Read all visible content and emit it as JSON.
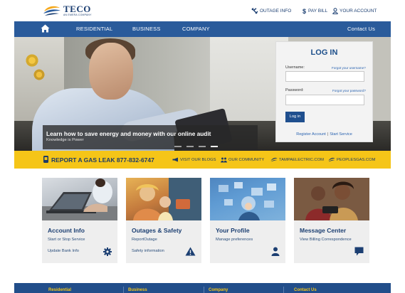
{
  "brand": {
    "name": "TECO",
    "tagline": "AN EMERA COMPANY"
  },
  "utility_links": {
    "outage": "OUTAGE INFO",
    "pay": "PAY BILL",
    "account": "YOUR ACCOUNT"
  },
  "nav": {
    "items": [
      "RESIDENTIAL",
      "BUSINESS",
      "COMPANY"
    ],
    "contact": "Contact Us"
  },
  "hero": {
    "title": "Learn how to save energy and money with our online audit",
    "subtitle": "Knowledge is Power",
    "slides_total": 4,
    "slide_active": 4
  },
  "login": {
    "title": "LOG IN",
    "username_label": "Username:",
    "forgot_username": "Forgot your username?",
    "password_label": "Password:",
    "forgot_password": "Forgot your password?",
    "button": "Log in",
    "register": "Register Account",
    "separator": "|",
    "start_service": "Start Service"
  },
  "gas_bar": {
    "report_text": "REPORT A GAS LEAK 877-832-6747",
    "links": {
      "blogs": "VISIT OUR BLOGS",
      "community": "OUR COMMUNITY",
      "tampa": "TAMPAELECTRIC.COM",
      "peoples": "PEOPLESGAS.COM"
    }
  },
  "cards": [
    {
      "title": "Account Info",
      "line1": "Start or Stop Service",
      "line2": "Update Bank Info",
      "icon": "gear-icon"
    },
    {
      "title": "Outages & Safety",
      "line1": "ReportOutage",
      "line2": "Safety information",
      "icon": "warning-icon"
    },
    {
      "title": "Your Profile",
      "line1": "Manage preferences",
      "line2": "",
      "icon": "user-icon"
    },
    {
      "title": "Message Center",
      "line1": "View Billing Correspondence",
      "line2": "",
      "icon": "chat-icon"
    }
  ],
  "footer": {
    "items": [
      "Residential",
      "Business",
      "Company",
      "Contact Us"
    ]
  },
  "colors": {
    "primary_blue": "#2a5b9b",
    "dark_blue": "#1c3f72",
    "accent_yellow": "#f5c518",
    "card_gray": "#eeeeee"
  }
}
